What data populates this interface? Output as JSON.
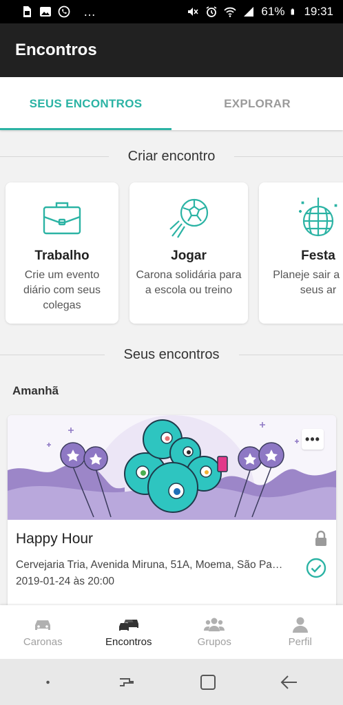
{
  "status_bar": {
    "battery": "61%",
    "time": "19:31",
    "more": "…"
  },
  "app_bar": {
    "title": "Encontros"
  },
  "tabs": [
    {
      "label": "SEUS ENCONTROS",
      "active": true
    },
    {
      "label": "EXPLORAR",
      "active": false
    }
  ],
  "create_section": {
    "title": "Criar encontro",
    "cards": [
      {
        "title": "Trabalho",
        "description": "Crie um evento diário com seus colegas",
        "icon": "briefcase-icon"
      },
      {
        "title": "Jogar",
        "description": "Carona solidária para a escola ou treino",
        "icon": "soccer-ball-icon"
      },
      {
        "title": "Festa",
        "description": "Planeje sair a com seus ar",
        "icon": "disco-ball-icon"
      }
    ]
  },
  "my_section": {
    "title": "Seus encontros",
    "day_label": "Amanhã",
    "event": {
      "title": "Happy Hour",
      "address": "Cervejaria Tria, Avenida Miruna, 51A, Moema, São Pa…",
      "datetime": "2019-01-24 às 20:00",
      "more_label": "•••"
    }
  },
  "bottom_nav": [
    {
      "label": "Caronas",
      "icon": "car-icon",
      "active": false
    },
    {
      "label": "Encontros",
      "icon": "cars-icon",
      "active": true
    },
    {
      "label": "Grupos",
      "icon": "group-icon",
      "active": false
    },
    {
      "label": "Perfil",
      "icon": "person-icon",
      "active": false
    }
  ],
  "colors": {
    "accent": "#2bb3a4",
    "app_bar": "#212121",
    "banner_purple": "#9c86c8"
  }
}
